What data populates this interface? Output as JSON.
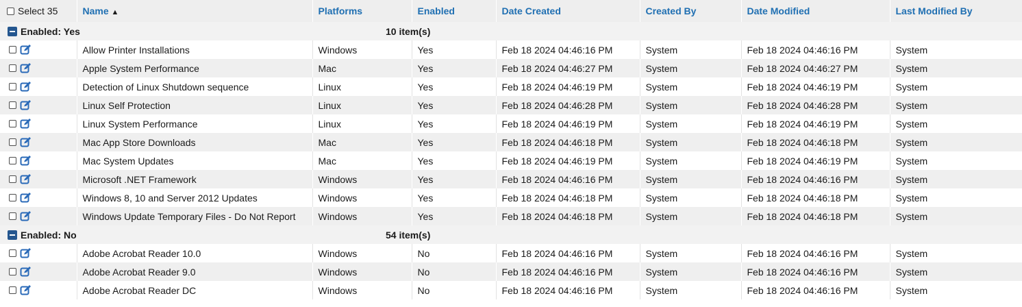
{
  "table": {
    "select_all_label": "Select 35",
    "columns": [
      "Name",
      "Platforms",
      "Enabled",
      "Date Created",
      "Created By",
      "Date Modified",
      "Last Modified By"
    ],
    "sort_indicator": "▲",
    "groups": [
      {
        "label": "Enabled: Yes",
        "count": "10 item(s)",
        "rows": [
          [
            "Allow Printer Installations",
            "Windows",
            "Yes",
            "Feb 18 2024 04:46:16 PM",
            "System",
            "Feb 18 2024 04:46:16 PM",
            "System"
          ],
          [
            "Apple System Performance",
            "Mac",
            "Yes",
            "Feb 18 2024 04:46:27 PM",
            "System",
            "Feb 18 2024 04:46:27 PM",
            "System"
          ],
          [
            "Detection of Linux Shutdown sequence",
            "Linux",
            "Yes",
            "Feb 18 2024 04:46:19 PM",
            "System",
            "Feb 18 2024 04:46:19 PM",
            "System"
          ],
          [
            "Linux Self Protection",
            "Linux",
            "Yes",
            "Feb 18 2024 04:46:28 PM",
            "System",
            "Feb 18 2024 04:46:28 PM",
            "System"
          ],
          [
            "Linux System Performance",
            "Linux",
            "Yes",
            "Feb 18 2024 04:46:19 PM",
            "System",
            "Feb 18 2024 04:46:19 PM",
            "System"
          ],
          [
            "Mac App Store Downloads",
            "Mac",
            "Yes",
            "Feb 18 2024 04:46:18 PM",
            "System",
            "Feb 18 2024 04:46:18 PM",
            "System"
          ],
          [
            "Mac System Updates",
            "Mac",
            "Yes",
            "Feb 18 2024 04:46:19 PM",
            "System",
            "Feb 18 2024 04:46:19 PM",
            "System"
          ],
          [
            "Microsoft .NET Framework",
            "Windows",
            "Yes",
            "Feb 18 2024 04:46:16 PM",
            "System",
            "Feb 18 2024 04:46:16 PM",
            "System"
          ],
          [
            "Windows 8, 10 and Server 2012 Updates",
            "Windows",
            "Yes",
            "Feb 18 2024 04:46:18 PM",
            "System",
            "Feb 18 2024 04:46:18 PM",
            "System"
          ],
          [
            "Windows Update Temporary Files - Do Not Report",
            "Windows",
            "Yes",
            "Feb 18 2024 04:46:18 PM",
            "System",
            "Feb 18 2024 04:46:18 PM",
            "System"
          ]
        ]
      },
      {
        "label": "Enabled: No",
        "count": "54 item(s)",
        "rows": [
          [
            "Adobe Acrobat Reader 10.0",
            "Windows",
            "No",
            "Feb 18 2024 04:46:16 PM",
            "System",
            "Feb 18 2024 04:46:16 PM",
            "System"
          ],
          [
            "Adobe Acrobat Reader 9.0",
            "Windows",
            "No",
            "Feb 18 2024 04:46:16 PM",
            "System",
            "Feb 18 2024 04:46:16 PM",
            "System"
          ],
          [
            "Adobe Acrobat Reader DC",
            "Windows",
            "No",
            "Feb 18 2024 04:46:16 PM",
            "System",
            "Feb 18 2024 04:46:16 PM",
            "System"
          ]
        ]
      }
    ]
  },
  "colors": {
    "header_link": "#1f6fb2",
    "group_icon": "#24568f",
    "edit_icon": "#2a6ab8"
  },
  "icons": {
    "group_toggle": "collapse-icon",
    "row_edit": "edit-icon"
  }
}
